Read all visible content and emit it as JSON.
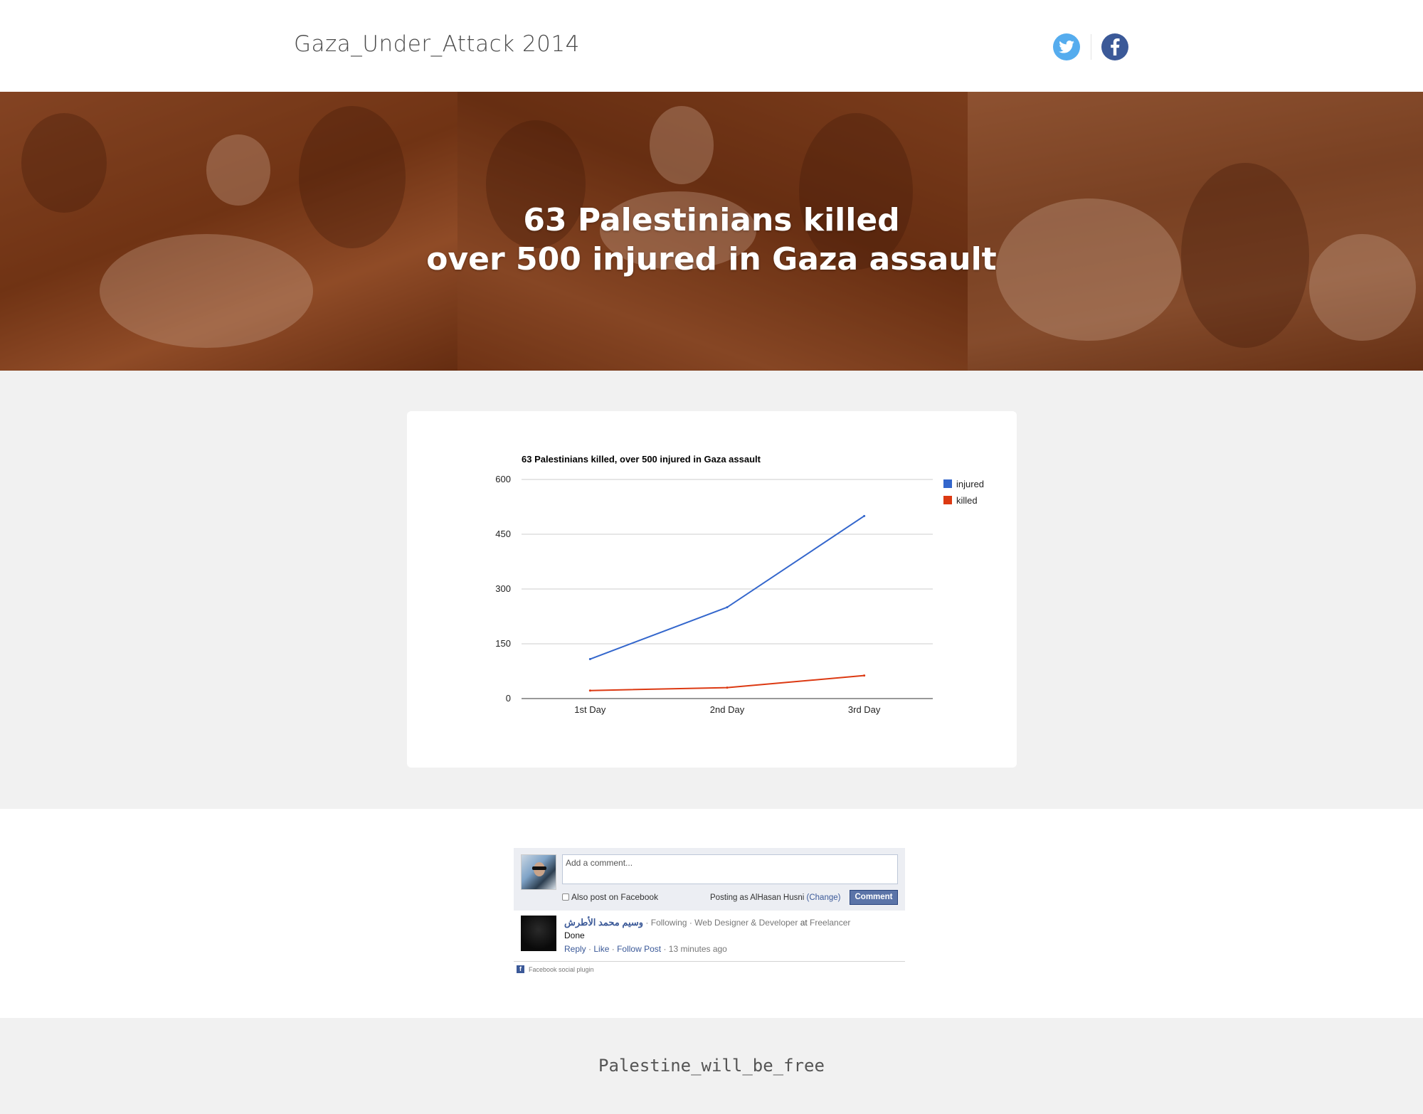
{
  "header": {
    "site_title": "Gaza_Under_Attack 2014",
    "twitter_icon": "twitter-icon",
    "facebook_icon": "facebook-icon",
    "colors": {
      "twitter": "#55acee",
      "facebook": "#3b5998"
    }
  },
  "hero": {
    "headline_line1": "63 Palestinians killed",
    "headline_line2": "over 500 injured in Gaza assault"
  },
  "chart_data": {
    "type": "line",
    "title": "63 Palestinians killed, over 500 injured in Gaza assault",
    "categories": [
      "1st Day",
      "2nd Day",
      "3rd Day"
    ],
    "series": [
      {
        "name": "injured",
        "values": [
          108,
          250,
          500
        ],
        "color": "#3366cc"
      },
      {
        "name": "killed",
        "values": [
          22,
          30,
          63
        ],
        "color": "#dc3912"
      }
    ],
    "ylim": [
      0,
      600
    ],
    "yticks": [
      0,
      150,
      300,
      450,
      600
    ],
    "grid": true,
    "legend": "right"
  },
  "comments": {
    "placeholder": "Add a comment...",
    "also_post_label": "Also post on Facebook",
    "posting_as_prefix": "Posting as AlHasan Husni",
    "change_link": "(Change)",
    "comment_button": "Comment",
    "items": [
      {
        "author": "وسيم محمد الأطرش",
        "following": "Following",
        "role": "Web Designer & Developer",
        "at": "at",
        "company": "Freelancer",
        "text": "Done",
        "reply": "Reply",
        "like": "Like",
        "follow_post": "Follow Post",
        "time": "13 minutes ago"
      }
    ],
    "plugin_label": "Facebook social plugin"
  },
  "footer": {
    "text": "Palestine_will_be_free"
  }
}
